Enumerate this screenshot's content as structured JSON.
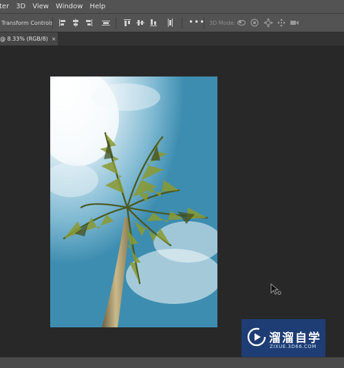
{
  "menubar": {
    "items": [
      "ter",
      "3D",
      "View",
      "Window",
      "Help"
    ]
  },
  "optionsbar": {
    "transform_controls_label": "Transform Controls",
    "more_label": "•••",
    "mode_3d_label": "3D Mode:",
    "icons": [
      "align-left-icon",
      "align-horizontal-center-icon",
      "align-right-icon",
      "distribute-horizontal-icon",
      "align-top-icon",
      "align-vertical-center-icon",
      "align-bottom-icon",
      "distribute-vertical-icon",
      "3d-orbit-icon",
      "3d-roll-icon",
      "3d-pan-icon",
      "3d-slide-icon",
      "3d-scale-icon"
    ]
  },
  "document_tab": {
    "title": "@ 8.33% (RGB/8)",
    "close_label": "×"
  },
  "canvas": {
    "background_color": "#282828",
    "image_description_icon": "palm-tree-photo"
  },
  "watermark": {
    "brand_text": "溜溜自学",
    "domain_text": "ZIXUE.3D66.COM",
    "color": "#1c4080"
  }
}
